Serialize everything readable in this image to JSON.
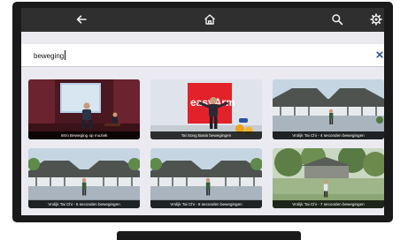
{
  "topbar": {
    "back_icon": "arrow-left-icon",
    "home_icon": "home-icon",
    "search_icon": "search-icon",
    "settings_icon": "gear-icon"
  },
  "search": {
    "value": "beweging",
    "clear_icon": "close-icon"
  },
  "results": [
    {
      "title": "Intro Beweging op muziek",
      "thumbnail": "presenter-on-stage"
    },
    {
      "title": "Tai Song Basis bewegingen",
      "thumbnail": "easy-arm-training-studio"
    },
    {
      "title": "Vrolijk Tai Chi - 4 seconden bewegingen",
      "thumbnail": "courtyard-pavilion"
    },
    {
      "title": "Vrolijk Tai Chi - 5 seconden bewegingen",
      "thumbnail": "courtyard-pavilion"
    },
    {
      "title": "Vrolijk Tai Chi - 6 seconden bewegingen",
      "thumbnail": "courtyard-pavilion"
    },
    {
      "title": "Vrolijk Tai Chi - 7 seconden bewegingen",
      "thumbnail": "garden-lawn"
    }
  ],
  "colors": {
    "topbar": "#2f2f2f",
    "tv_frame": "#1a1a1a",
    "accent": "#1e4e9a",
    "grid_bg": "#eaeaf0"
  }
}
